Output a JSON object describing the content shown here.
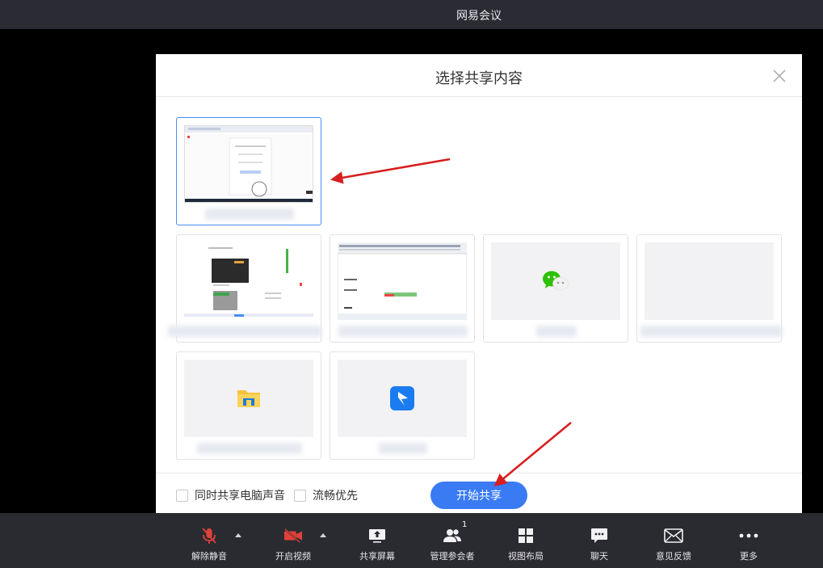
{
  "window": {
    "title": "网易会议"
  },
  "dialog": {
    "title": "选择共享内容",
    "tiles": [
      {
        "kind": "screen",
        "label": ""
      },
      {
        "kind": "window-doc",
        "label": ""
      },
      {
        "kind": "window-sheet",
        "label": ""
      },
      {
        "kind": "app-wechat",
        "label": ""
      },
      {
        "kind": "blank",
        "label": ""
      },
      {
        "kind": "app-explorer",
        "label": ""
      },
      {
        "kind": "app-feishu",
        "label": ""
      }
    ],
    "footer": {
      "share_audio_label": "同时共享电脑声音",
      "smooth_label": "流畅优先",
      "start_label": "开始共享"
    }
  },
  "toolbar": {
    "unmute_label": "解除静音",
    "video_label": "开启视频",
    "share_label": "共享屏幕",
    "participants_label": "管理参会者",
    "participants_count": "1",
    "layout_label": "视图布局",
    "chat_label": "聊天",
    "feedback_label": "意见反馈",
    "more_label": "更多"
  },
  "colors": {
    "accent": "#3a7bf4",
    "muted_red": "#e0413a",
    "toolbar_bg": "#2a2b31",
    "annotation_arrow": "#d81f1f"
  }
}
